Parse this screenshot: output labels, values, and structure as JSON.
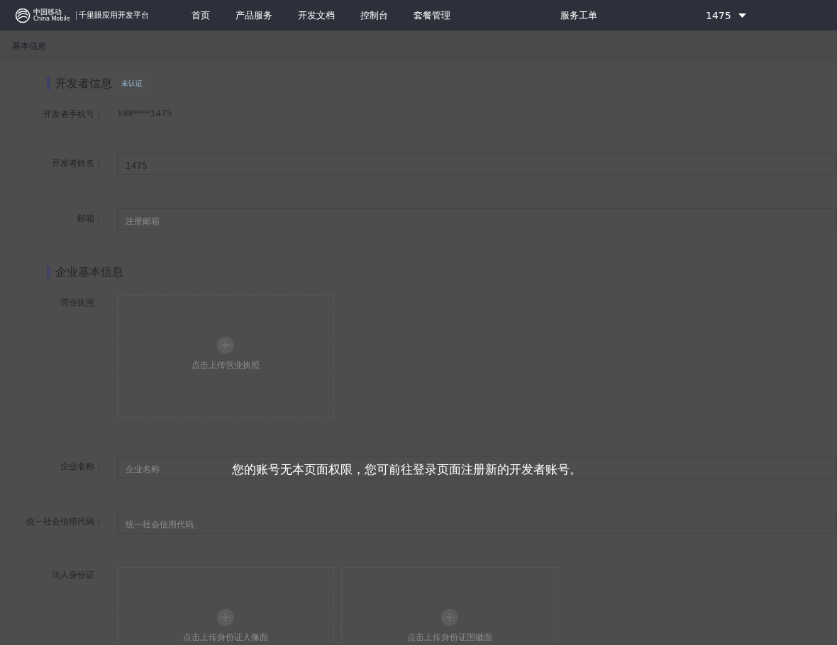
{
  "nav": {
    "logo_cn": "中国移动",
    "logo_en": "China Mobile",
    "platform": "千里眼应用开发平台",
    "items": [
      {
        "label": "首页"
      },
      {
        "label": "产品服务"
      },
      {
        "label": "开发文档"
      },
      {
        "label": "控制台"
      },
      {
        "label": "套餐管理"
      }
    ],
    "service": "服务工单",
    "user": "1475"
  },
  "breadcrumb": "基本信息",
  "sections": [
    {
      "title": "开发者信息",
      "badge": "未认证",
      "fields": [
        {
          "kind": "text",
          "label": "开发者手机号：",
          "value": "188****1475"
        },
        {
          "kind": "input",
          "label": "开发者姓名：",
          "value": "1475"
        },
        {
          "kind": "input",
          "label": "邮箱：",
          "placeholder": "注册邮箱"
        }
      ]
    },
    {
      "title": "企业基本信息",
      "fields": [
        {
          "kind": "upload",
          "label": "营业执照：",
          "uploads": [
            "点击上传营业执照"
          ]
        },
        {
          "kind": "input",
          "label": "企业名称：",
          "placeholder": "企业名称"
        },
        {
          "kind": "input",
          "label": "统一社会信用代码：",
          "placeholder": "统一社会信用代码"
        },
        {
          "kind": "upload",
          "label": "法人身份证：",
          "uploads": [
            "点击上传身份证人像面",
            "点击上传身份证国徽面"
          ]
        }
      ]
    }
  ],
  "notice": "您的账号无本页面权限，您可前往登录页面注册新的开发者账号。"
}
